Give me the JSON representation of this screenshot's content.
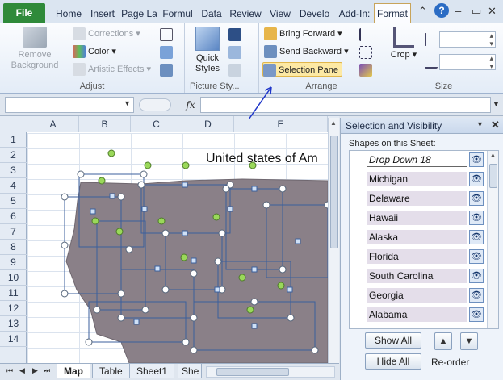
{
  "tabs": [
    {
      "label": "File",
      "kind": "file"
    },
    {
      "label": "Home"
    },
    {
      "label": "Insert"
    },
    {
      "label": "Page La"
    },
    {
      "label": "Formul"
    },
    {
      "label": "Data"
    },
    {
      "label": "Review"
    },
    {
      "label": "View"
    },
    {
      "label": "Develo"
    },
    {
      "label": "Add-In:"
    },
    {
      "label": "Format",
      "kind": "active"
    }
  ],
  "colors": {
    "file_tab": "#2f8a3a",
    "selection_highlight": "#fde9a4",
    "shape_fill": "#8a8088",
    "handle": "#9ad85a"
  },
  "ribbon": {
    "adjust": {
      "remove_background": "Remove Background",
      "corrections": "Corrections",
      "color": "Color",
      "artistic_effects": "Artistic Effects",
      "label": "Adjust"
    },
    "picture_styles": {
      "quick_styles": "Quick Styles",
      "label": "Picture Sty..."
    },
    "arrange": {
      "bring_forward": "Bring Forward",
      "send_backward": "Send Backward",
      "selection_pane": "Selection Pane",
      "label": "Arrange"
    },
    "size": {
      "crop": "Crop",
      "label": "Size"
    }
  },
  "formula": {
    "fx": "fx"
  },
  "columns": [
    "A",
    "B",
    "C",
    "D",
    "E"
  ],
  "rows": [
    "1",
    "2",
    "3",
    "4",
    "5",
    "6",
    "7",
    "8",
    "9",
    "10",
    "11",
    "12",
    "13",
    "14"
  ],
  "sheet_title": "United states of Am",
  "sheet_tabs": [
    "Map",
    "Table",
    "Sheet1",
    "She"
  ],
  "pane": {
    "title": "Selection and Visibility",
    "shapes_label": "Shapes on this Sheet:",
    "shapes": [
      "Drop Down 18",
      "Michigan",
      "Delaware",
      "Hawaii",
      "Alaska",
      "Florida",
      "South Carolina",
      "Georgia",
      "Alabama"
    ],
    "show_all": "Show All",
    "hide_all": "Hide All",
    "reorder": "Re-order"
  }
}
